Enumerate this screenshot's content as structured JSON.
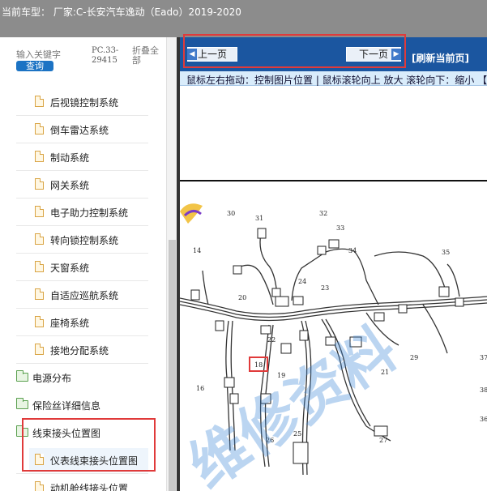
{
  "window": {
    "title": "当前车型： 厂家:C-长安汽车逸动（Eado）2019-2020"
  },
  "search": {
    "keyword_label": "输入关键字",
    "query_button": "查询",
    "pc_code": "PC.33-29415",
    "fold_all": "折叠全部"
  },
  "tree": {
    "items": [
      {
        "label": "后视镜控制系统",
        "type": "doc"
      },
      {
        "label": "倒车雷达系统",
        "type": "doc"
      },
      {
        "label": "制动系统",
        "type": "doc"
      },
      {
        "label": "网关系统",
        "type": "doc"
      },
      {
        "label": "电子助力控制系统",
        "type": "doc"
      },
      {
        "label": "转向锁控制系统",
        "type": "doc"
      },
      {
        "label": "天窗系统",
        "type": "doc"
      },
      {
        "label": "自适应巡航系统",
        "type": "doc"
      },
      {
        "label": "座椅系统",
        "type": "doc"
      },
      {
        "label": "接地分配系统",
        "type": "doc"
      },
      {
        "label": "电源分布",
        "type": "folder"
      },
      {
        "label": "保险丝详细信息",
        "type": "folder"
      },
      {
        "label": "线束接头位置图",
        "type": "folder"
      },
      {
        "label": "仪表线束接头位置图",
        "type": "doc",
        "selected": true
      },
      {
        "label": "动机舱线接头位置",
        "type": "doc"
      }
    ]
  },
  "viewer": {
    "prev_label": "上一页",
    "next_label": "下一页",
    "refresh_label": "[刷新当前页]",
    "hint": "鼠标左右拖动：控制图片位置 | 鼠标滚轮向上 放大   滚轮向下：缩小 【",
    "watermark": "维修资料"
  },
  "diagram_labels": [
    "30",
    "31",
    "32",
    "33",
    "34",
    "35",
    "14",
    "24",
    "23",
    "20",
    "22",
    "18",
    "19",
    "29",
    "21",
    "37",
    "16",
    "25",
    "26",
    "27",
    "38",
    "36"
  ],
  "colors": {
    "nav_bar": "#1b56a0",
    "hint_bar": "#d9ecfb",
    "annotation": "#e03a3a",
    "title_bar": "#8c8c8c"
  }
}
